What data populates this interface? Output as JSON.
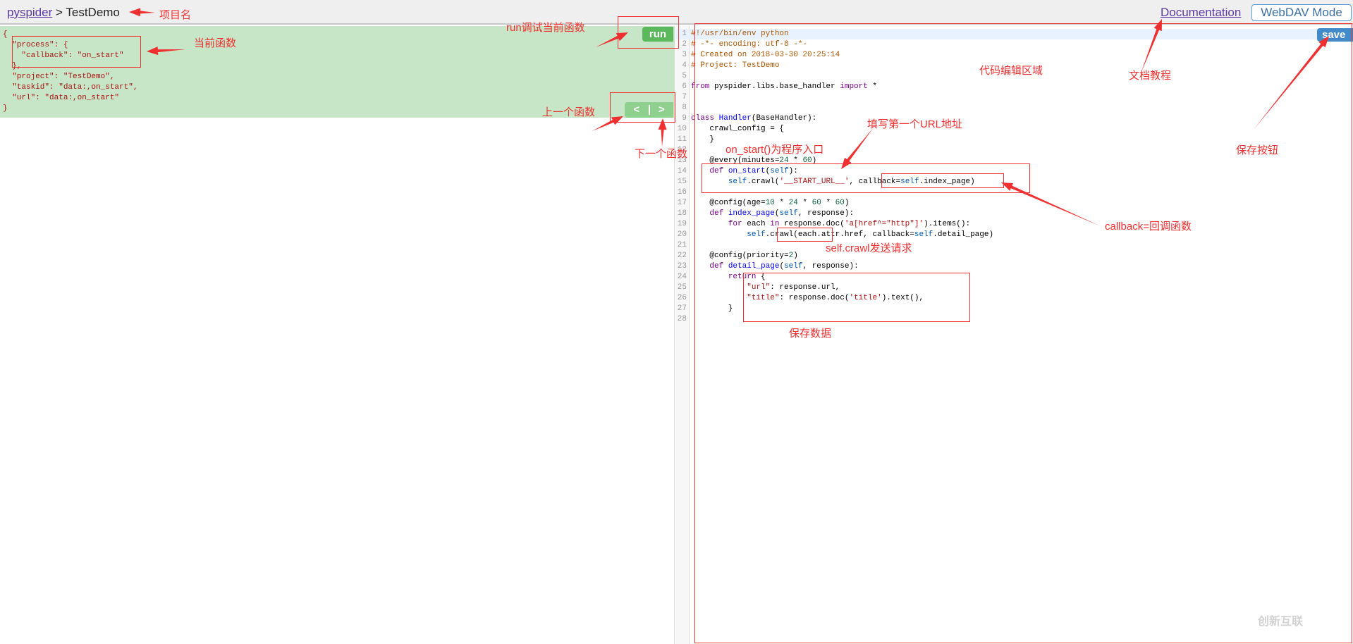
{
  "header": {
    "project_link": "pyspider",
    "separator": ">",
    "project_name": "TestDemo",
    "documentation": "Documentation",
    "webdav": "WebDAV Mode"
  },
  "task_panel": {
    "lines": [
      "{",
      "  \"process\": {",
      "    \"callback\": \"on_start\"",
      "  },",
      "  \"project\": \"TestDemo\",",
      "  \"taskid\": \"data:,on_start\",",
      "  \"url\": \"data:,on_start\"",
      "}"
    ],
    "run_label": "run",
    "prev_label": "<",
    "next_label": ">"
  },
  "editor": {
    "save_label": "save",
    "active_line": 1,
    "lines": [
      [
        [
          "#!/usr/bin/env python",
          "comment"
        ]
      ],
      [
        [
          "# -*- encoding: utf-8 -*-",
          "comment"
        ]
      ],
      [
        [
          "# Created on 2018-03-30 20:25:14",
          "comment"
        ]
      ],
      [
        [
          "# Project: TestDemo",
          "comment"
        ]
      ],
      [],
      [
        [
          "from",
          "kw"
        ],
        [
          " pyspider.libs.base_handler ",
          ""
        ],
        [
          "import",
          "kw"
        ],
        [
          " *",
          ""
        ]
      ],
      [],
      [],
      [
        [
          "class",
          "kw"
        ],
        [
          " ",
          ""
        ],
        [
          "Handler",
          "def"
        ],
        [
          "(BaseHandler):",
          ""
        ]
      ],
      [
        [
          "    crawl_config = {",
          ""
        ]
      ],
      [
        [
          "    }",
          ""
        ]
      ],
      [],
      [
        [
          "    @every(minutes=",
          ""
        ],
        [
          "24",
          "num"
        ],
        [
          " * ",
          ""
        ],
        [
          "60",
          "num"
        ],
        [
          ")",
          ""
        ]
      ],
      [
        [
          "    ",
          ""
        ],
        [
          "def",
          "kw"
        ],
        [
          " ",
          ""
        ],
        [
          "on_start",
          "def"
        ],
        [
          "(",
          ""
        ],
        [
          "self",
          "var"
        ],
        [
          "):",
          ""
        ]
      ],
      [
        [
          "        ",
          ""
        ],
        [
          "self",
          "var"
        ],
        [
          ".crawl(",
          ""
        ],
        [
          "'__START_URL__'",
          "str"
        ],
        [
          ", callback=",
          ""
        ],
        [
          "self",
          "var"
        ],
        [
          ".index_page)",
          ""
        ]
      ],
      [],
      [
        [
          "    @config(age=",
          ""
        ],
        [
          "10",
          "num"
        ],
        [
          " * ",
          ""
        ],
        [
          "24",
          "num"
        ],
        [
          " * ",
          ""
        ],
        [
          "60",
          "num"
        ],
        [
          " * ",
          ""
        ],
        [
          "60",
          "num"
        ],
        [
          ")",
          ""
        ]
      ],
      [
        [
          "    ",
          ""
        ],
        [
          "def",
          "kw"
        ],
        [
          " ",
          ""
        ],
        [
          "index_page",
          "def"
        ],
        [
          "(",
          ""
        ],
        [
          "self",
          "var"
        ],
        [
          ", response):",
          ""
        ]
      ],
      [
        [
          "        ",
          ""
        ],
        [
          "for",
          "kw"
        ],
        [
          " each ",
          ""
        ],
        [
          "in",
          "kw"
        ],
        [
          " response.doc(",
          ""
        ],
        [
          "'a[href^=\"http\"]'",
          "str"
        ],
        [
          ").items():",
          ""
        ]
      ],
      [
        [
          "            ",
          ""
        ],
        [
          "self",
          "var"
        ],
        [
          ".crawl(each.attr.href, callback=",
          ""
        ],
        [
          "self",
          "var"
        ],
        [
          ".detail_page)",
          ""
        ]
      ],
      [],
      [
        [
          "    @config(priority=",
          ""
        ],
        [
          "2",
          "num"
        ],
        [
          ")",
          ""
        ]
      ],
      [
        [
          "    ",
          ""
        ],
        [
          "def",
          "kw"
        ],
        [
          " ",
          ""
        ],
        [
          "detail_page",
          "def"
        ],
        [
          "(",
          ""
        ],
        [
          "self",
          "var"
        ],
        [
          ", response):",
          ""
        ]
      ],
      [
        [
          "        ",
          ""
        ],
        [
          "return",
          "kw"
        ],
        [
          " {",
          ""
        ]
      ],
      [
        [
          "            ",
          ""
        ],
        [
          "\"url\"",
          "str"
        ],
        [
          ": response.url,",
          ""
        ]
      ],
      [
        [
          "            ",
          ""
        ],
        [
          "\"title\"",
          "str"
        ],
        [
          ": response.doc(",
          ""
        ],
        [
          "'title'",
          "str"
        ],
        [
          ").text(),",
          ""
        ]
      ],
      [
        [
          "        }",
          ""
        ]
      ],
      []
    ]
  },
  "annotations": {
    "project_name": "项目名",
    "current_function": "当前函数",
    "run_debug": "run调试当前函数",
    "prev_function": "上一个函数",
    "next_function": "下一个函数",
    "code_area": "代码编辑区域",
    "docs": "文档教程",
    "first_url": "填写第一个URL地址",
    "entry": "on_start()为程序入口",
    "save_button": "保存按钮",
    "callback": "callback=回调函数",
    "crawl_request": "self.crawl发送请求",
    "save_data": "保存数据"
  },
  "watermark": {
    "logo_text": "创新互联"
  },
  "colors": {
    "annotation": "#f03030",
    "task_bg": "#c7e6c7",
    "run": "#5cb85c",
    "save": "#428bca"
  }
}
